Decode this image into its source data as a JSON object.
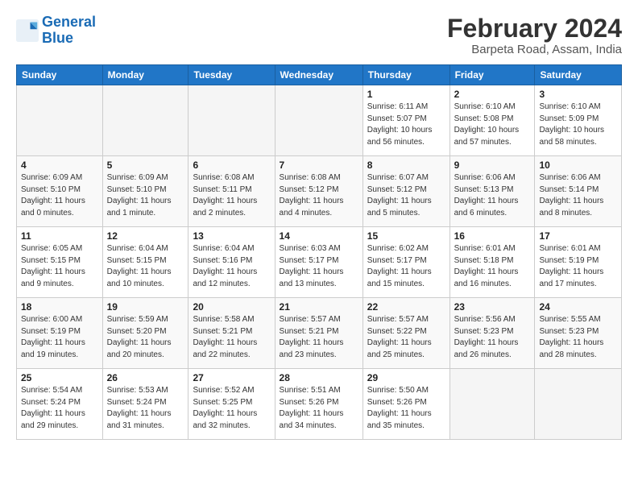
{
  "logo": {
    "line1": "General",
    "line2": "Blue"
  },
  "title": "February 2024",
  "subtitle": "Barpeta Road, Assam, India",
  "headers": [
    "Sunday",
    "Monday",
    "Tuesday",
    "Wednesday",
    "Thursday",
    "Friday",
    "Saturday"
  ],
  "weeks": [
    [
      {
        "num": "",
        "info": ""
      },
      {
        "num": "",
        "info": ""
      },
      {
        "num": "",
        "info": ""
      },
      {
        "num": "",
        "info": ""
      },
      {
        "num": "1",
        "info": "Sunrise: 6:11 AM\nSunset: 5:07 PM\nDaylight: 10 hours\nand 56 minutes."
      },
      {
        "num": "2",
        "info": "Sunrise: 6:10 AM\nSunset: 5:08 PM\nDaylight: 10 hours\nand 57 minutes."
      },
      {
        "num": "3",
        "info": "Sunrise: 6:10 AM\nSunset: 5:09 PM\nDaylight: 10 hours\nand 58 minutes."
      }
    ],
    [
      {
        "num": "4",
        "info": "Sunrise: 6:09 AM\nSunset: 5:10 PM\nDaylight: 11 hours\nand 0 minutes."
      },
      {
        "num": "5",
        "info": "Sunrise: 6:09 AM\nSunset: 5:10 PM\nDaylight: 11 hours\nand 1 minute."
      },
      {
        "num": "6",
        "info": "Sunrise: 6:08 AM\nSunset: 5:11 PM\nDaylight: 11 hours\nand 2 minutes."
      },
      {
        "num": "7",
        "info": "Sunrise: 6:08 AM\nSunset: 5:12 PM\nDaylight: 11 hours\nand 4 minutes."
      },
      {
        "num": "8",
        "info": "Sunrise: 6:07 AM\nSunset: 5:12 PM\nDaylight: 11 hours\nand 5 minutes."
      },
      {
        "num": "9",
        "info": "Sunrise: 6:06 AM\nSunset: 5:13 PM\nDaylight: 11 hours\nand 6 minutes."
      },
      {
        "num": "10",
        "info": "Sunrise: 6:06 AM\nSunset: 5:14 PM\nDaylight: 11 hours\nand 8 minutes."
      }
    ],
    [
      {
        "num": "11",
        "info": "Sunrise: 6:05 AM\nSunset: 5:15 PM\nDaylight: 11 hours\nand 9 minutes."
      },
      {
        "num": "12",
        "info": "Sunrise: 6:04 AM\nSunset: 5:15 PM\nDaylight: 11 hours\nand 10 minutes."
      },
      {
        "num": "13",
        "info": "Sunrise: 6:04 AM\nSunset: 5:16 PM\nDaylight: 11 hours\nand 12 minutes."
      },
      {
        "num": "14",
        "info": "Sunrise: 6:03 AM\nSunset: 5:17 PM\nDaylight: 11 hours\nand 13 minutes."
      },
      {
        "num": "15",
        "info": "Sunrise: 6:02 AM\nSunset: 5:17 PM\nDaylight: 11 hours\nand 15 minutes."
      },
      {
        "num": "16",
        "info": "Sunrise: 6:01 AM\nSunset: 5:18 PM\nDaylight: 11 hours\nand 16 minutes."
      },
      {
        "num": "17",
        "info": "Sunrise: 6:01 AM\nSunset: 5:19 PM\nDaylight: 11 hours\nand 17 minutes."
      }
    ],
    [
      {
        "num": "18",
        "info": "Sunrise: 6:00 AM\nSunset: 5:19 PM\nDaylight: 11 hours\nand 19 minutes."
      },
      {
        "num": "19",
        "info": "Sunrise: 5:59 AM\nSunset: 5:20 PM\nDaylight: 11 hours\nand 20 minutes."
      },
      {
        "num": "20",
        "info": "Sunrise: 5:58 AM\nSunset: 5:21 PM\nDaylight: 11 hours\nand 22 minutes."
      },
      {
        "num": "21",
        "info": "Sunrise: 5:57 AM\nSunset: 5:21 PM\nDaylight: 11 hours\nand 23 minutes."
      },
      {
        "num": "22",
        "info": "Sunrise: 5:57 AM\nSunset: 5:22 PM\nDaylight: 11 hours\nand 25 minutes."
      },
      {
        "num": "23",
        "info": "Sunrise: 5:56 AM\nSunset: 5:23 PM\nDaylight: 11 hours\nand 26 minutes."
      },
      {
        "num": "24",
        "info": "Sunrise: 5:55 AM\nSunset: 5:23 PM\nDaylight: 11 hours\nand 28 minutes."
      }
    ],
    [
      {
        "num": "25",
        "info": "Sunrise: 5:54 AM\nSunset: 5:24 PM\nDaylight: 11 hours\nand 29 minutes."
      },
      {
        "num": "26",
        "info": "Sunrise: 5:53 AM\nSunset: 5:24 PM\nDaylight: 11 hours\nand 31 minutes."
      },
      {
        "num": "27",
        "info": "Sunrise: 5:52 AM\nSunset: 5:25 PM\nDaylight: 11 hours\nand 32 minutes."
      },
      {
        "num": "28",
        "info": "Sunrise: 5:51 AM\nSunset: 5:26 PM\nDaylight: 11 hours\nand 34 minutes."
      },
      {
        "num": "29",
        "info": "Sunrise: 5:50 AM\nSunset: 5:26 PM\nDaylight: 11 hours\nand 35 minutes."
      },
      {
        "num": "",
        "info": ""
      },
      {
        "num": "",
        "info": ""
      }
    ]
  ]
}
